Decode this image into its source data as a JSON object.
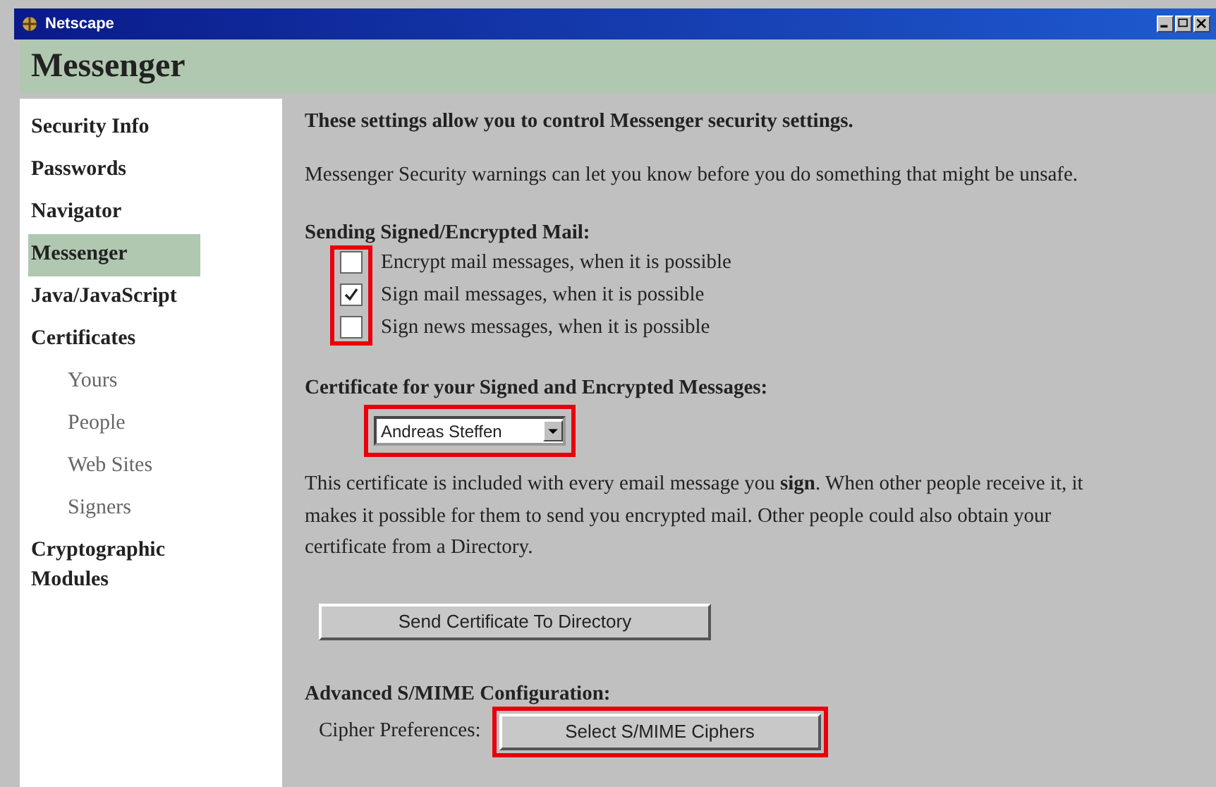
{
  "window": {
    "title": "Netscape"
  },
  "header": {
    "title": "Messenger"
  },
  "sidebar": {
    "items": [
      {
        "label": "Security Info",
        "selected": false
      },
      {
        "label": "Passwords",
        "selected": false
      },
      {
        "label": "Navigator",
        "selected": false
      },
      {
        "label": "Messenger",
        "selected": true
      },
      {
        "label": "Java/JavaScript",
        "selected": false
      },
      {
        "label": "Certificates",
        "selected": false,
        "children": [
          {
            "label": "Yours",
            "selected": false
          },
          {
            "label": "People",
            "selected": false
          },
          {
            "label": "Web Sites",
            "selected": false
          },
          {
            "label": "Signers",
            "selected": false
          }
        ]
      },
      {
        "label": "Cryptographic Modules",
        "selected": false
      }
    ]
  },
  "content": {
    "intro": "These settings allow you to control Messenger security settings.",
    "warning": "Messenger Security warnings can let you know before you do something that might be unsafe.",
    "sending": {
      "heading": "Sending Signed/Encrypted Mail:",
      "highlighted": true,
      "options": [
        {
          "label": "Encrypt mail messages, when it is possible",
          "checked": false
        },
        {
          "label": "Sign mail messages, when it is possible",
          "checked": true
        },
        {
          "label": "Sign news messages, when it is possible",
          "checked": false
        }
      ]
    },
    "certificate": {
      "heading": "Certificate for your Signed and Encrypted Messages:",
      "value": "Andreas Steffen",
      "highlighted": true,
      "note": "This certificate is included with every email message you **sign**. When other people receive it, it makes it possible for them to send you encrypted mail. Other people could also obtain your certificate from a Directory.",
      "button": "Send Certificate To Directory"
    },
    "advanced": {
      "heading": "Advanced S/MIME Configuration:",
      "label": "Cipher Preferences:",
      "button": "Select S/MIME Ciphers",
      "highlighted": true
    }
  }
}
